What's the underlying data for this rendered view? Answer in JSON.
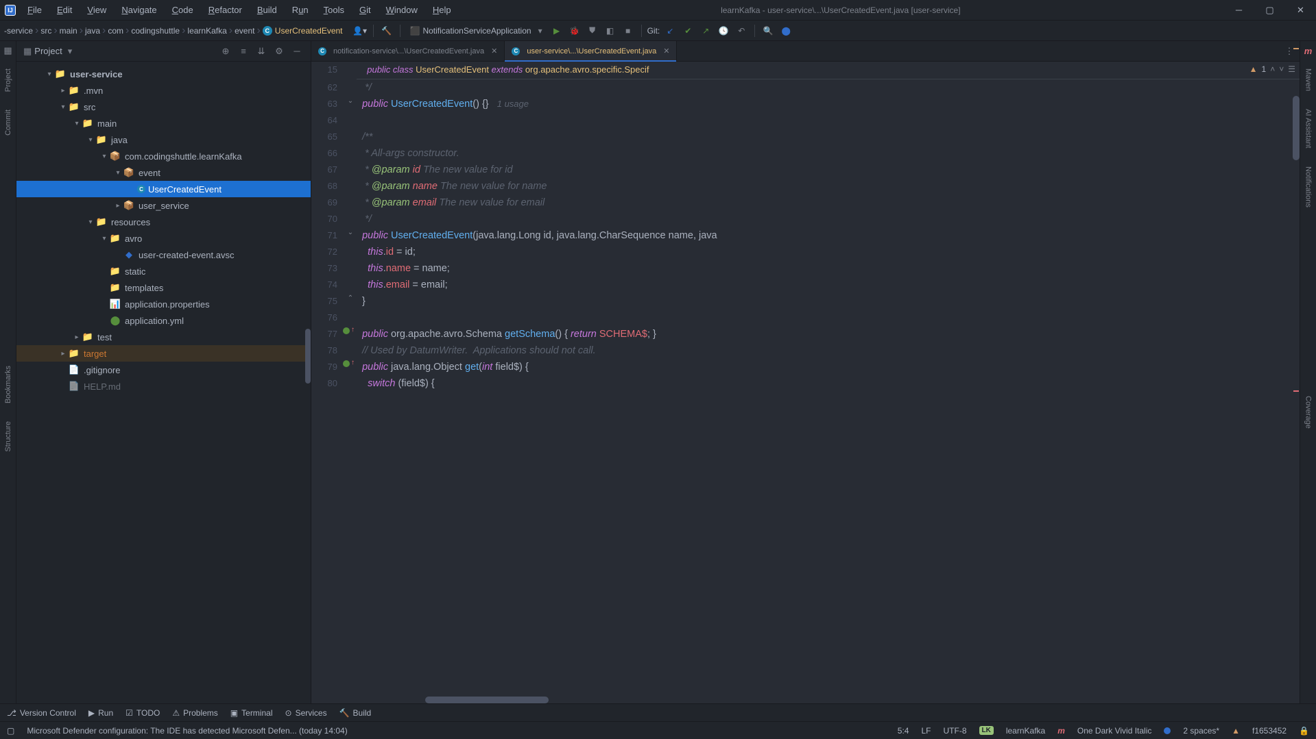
{
  "title": "learnKafka - user-service\\...\\UserCreatedEvent.java [user-service]",
  "menus": [
    "File",
    "Edit",
    "View",
    "Navigate",
    "Code",
    "Refactor",
    "Build",
    "Run",
    "Tools",
    "Git",
    "Window",
    "Help"
  ],
  "breadcrumb": [
    "-service",
    "src",
    "main",
    "java",
    "com",
    "codingshuttle",
    "learnKafka",
    "event"
  ],
  "breadcrumb_last": "UserCreatedEvent",
  "run_config": "NotificationServiceApplication",
  "git_label": "Git:",
  "panel": {
    "title": "Project"
  },
  "tree": {
    "root": "user-service",
    "mvn": ".mvn",
    "src": "src",
    "main_": "main",
    "java": "java",
    "pkg": "com.codingshuttle.learnKafka",
    "event": "event",
    "usercreated": "UserCreatedEvent",
    "userservice": "user_service",
    "resources": "resources",
    "avro": "avro",
    "avsc": "user-created-event.avsc",
    "static_": "static",
    "templates": "templates",
    "approps": "application.properties",
    "appyml": "application.yml",
    "test": "test",
    "target": "target",
    "gitignore": ".gitignore",
    "help": "HELP.md"
  },
  "tabs": [
    {
      "label": "notification-service\\...\\UserCreatedEvent.java",
      "active": false
    },
    {
      "label": "user-service\\...\\UserCreatedEvent.java",
      "active": true
    }
  ],
  "left_tools": [
    "Project",
    "Commit",
    "Bookmarks",
    "Structure"
  ],
  "right_tools": [
    "Maven",
    "AI Assistant",
    "Notifications",
    "Coverage"
  ],
  "bottom_tools": [
    "Version Control",
    "Run",
    "TODO",
    "Problems",
    "Terminal",
    "Services",
    "Build"
  ],
  "status": {
    "msg": "Microsoft Defender configuration: The IDE has detected Microsoft Defen... (today 14:04)",
    "pos": "5:4",
    "eol": "LF",
    "enc": "UTF-8",
    "project": "learnKafka",
    "theme": "One Dark Vivid Italic",
    "indent": "2 spaces*",
    "commit": "f1653452"
  },
  "sticky_line": "15",
  "inspect": {
    "count": "1"
  },
  "code": {
    "lines": [
      15,
      62,
      63,
      64,
      65,
      66,
      67,
      68,
      69,
      70,
      71,
      72,
      73,
      74,
      75,
      76,
      77,
      78,
      79,
      80
    ],
    "usage_hint": "1 usage"
  }
}
